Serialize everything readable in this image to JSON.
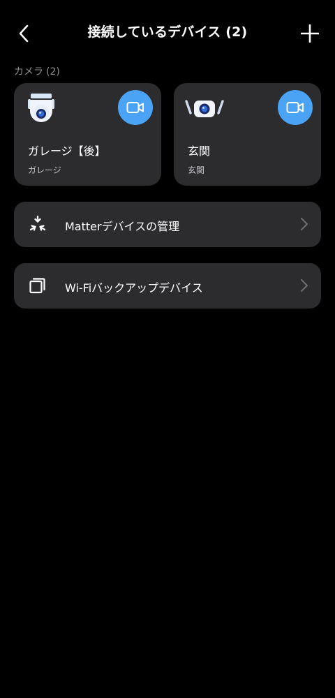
{
  "header": {
    "title": "接続しているデバイス (2)"
  },
  "section": {
    "label": "カメラ",
    "count": "(2)"
  },
  "cameras": [
    {
      "name": "ガレージ【後】",
      "location": "ガレージ",
      "icon": "ptz-camera-icon"
    },
    {
      "name": "玄関",
      "location": "玄関",
      "icon": "outdoor-camera-icon"
    }
  ],
  "rows": [
    {
      "label": "Matterデバイスの管理",
      "icon": "matter-icon"
    },
    {
      "label": "Wi-Fiバックアップデバイス",
      "icon": "backup-devices-icon"
    }
  ],
  "colors": {
    "background": "#000000",
    "card": "#2c2c2e",
    "accent": "#4aa3f5",
    "secondary_text": "#8e8e93"
  }
}
